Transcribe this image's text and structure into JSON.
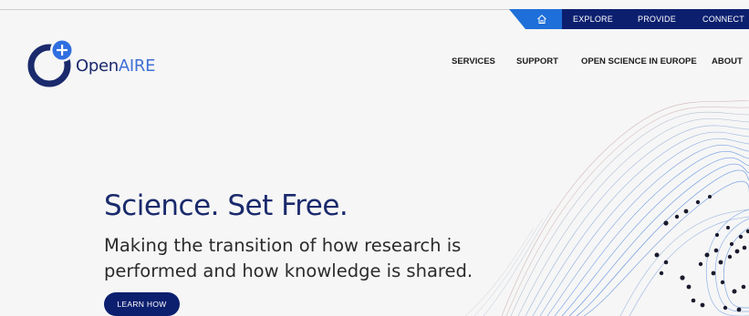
{
  "utility_nav": {
    "home_icon": "home-icon",
    "items": [
      "EXPLORE",
      "PROVIDE",
      "CONNECT"
    ]
  },
  "brand": {
    "name_prefix": "Open",
    "name_suffix": "AIRE",
    "logo_icon": "openaire-logo-icon"
  },
  "main_nav": {
    "items": [
      "SERVICES",
      "SUPPORT",
      "OPEN SCIENCE IN EUROPE",
      "ABOUT"
    ]
  },
  "hero": {
    "title": "Science. Set Free.",
    "subtitle": "Making the transition of how research is performed and how knowledge is shared.",
    "cta_label": "LEARN HOW"
  },
  "colors": {
    "navy": "#0c1f6f",
    "home_tab_blue": "#1e6fd9",
    "logo_plus_blue": "#2f6fe0",
    "background": "#f6f6f6"
  }
}
